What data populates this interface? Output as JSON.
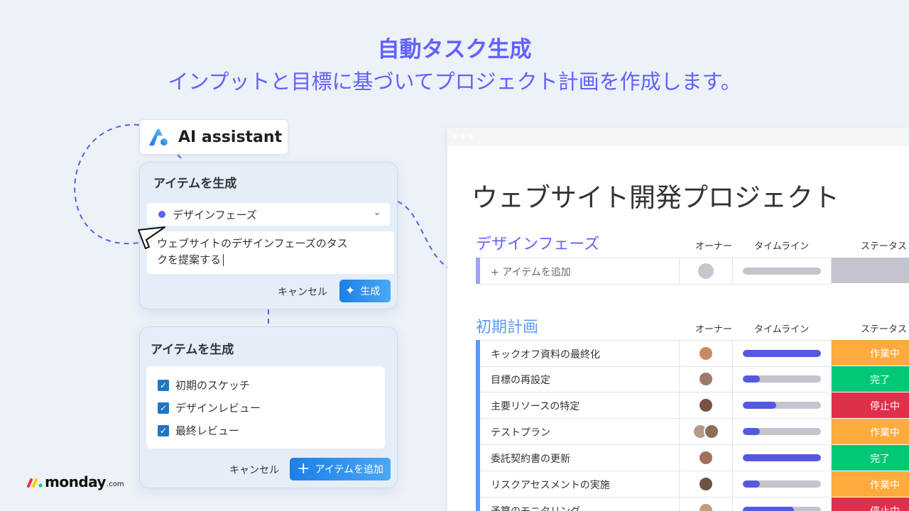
{
  "hero": {
    "title": "自動タスク生成",
    "subtitle": "インプットと目標に基づいてプロジェクト計画を作成します。"
  },
  "ai_badge": {
    "label": "AI assistant"
  },
  "generate_card": {
    "title": "アイテムを生成",
    "group_select": "デザインフェーズ",
    "prompt_line1": "ウェブサイトのデザインフェーズのタス",
    "prompt_line2": "クを提案する",
    "cancel_label": "キャンセル",
    "generate_label": "生成"
  },
  "results_card": {
    "title": "アイテムを生成",
    "items": [
      {
        "label": "初期のスケッチ",
        "checked": true
      },
      {
        "label": "デザインレビュー",
        "checked": true
      },
      {
        "label": "最終レビュー",
        "checked": true
      }
    ],
    "cancel_label": "キャンセル",
    "add_label": "アイテムを追加"
  },
  "logo": {
    "word": "monday",
    "domain": ".com"
  },
  "board": {
    "title": "ウェブサイト開発プロジェクト",
    "columns": {
      "owner": "オーナー",
      "timeline": "タイムライン",
      "status": "ステータス"
    },
    "groups": [
      {
        "name": "デザインフェーズ",
        "color": "#6161ff",
        "add_item": "+ アイテムを追加"
      },
      {
        "name": "初期計画",
        "color": "#579bfc",
        "rows": [
          {
            "name": "キックオフ資料の最終化",
            "timeline_progress": 1.0,
            "status": "作業中",
            "status_color": "#fdab3d"
          },
          {
            "name": "目標の再設定",
            "timeline_progress": 0.22,
            "status": "完了",
            "status_color": "#00c875"
          },
          {
            "name": "主要リソースの特定",
            "timeline_progress": 0.43,
            "status": "停止中",
            "status_color": "#df2f4a"
          },
          {
            "name": "テストプラン",
            "timeline_progress": 0.22,
            "status": "作業中",
            "status_color": "#fdab3d"
          },
          {
            "name": "委託契約書の更新",
            "timeline_progress": 1.0,
            "status": "完了",
            "status_color": "#00c875"
          },
          {
            "name": "リスクアセスメントの実施",
            "timeline_progress": 0.22,
            "status": "作業中",
            "status_color": "#fdab3d"
          },
          {
            "name": "予算のモニタリング",
            "timeline_progress": 0.65,
            "status": "停止中",
            "status_color": "#df2f4a"
          }
        ]
      }
    ]
  }
}
